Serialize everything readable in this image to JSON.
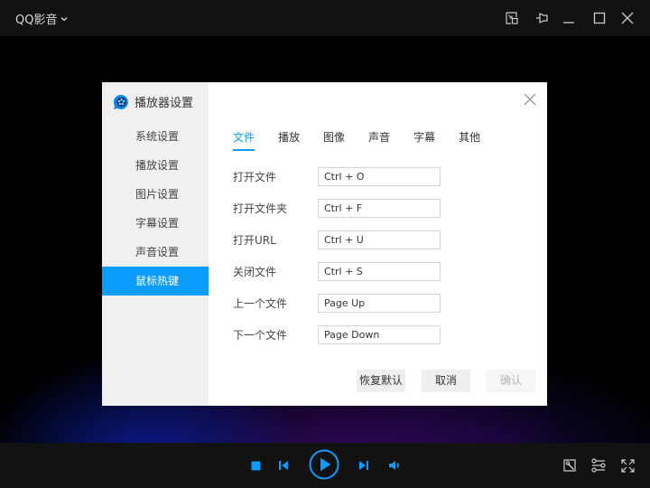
{
  "app": {
    "title": "QQ影音",
    "window_controls": [
      "mini-mode",
      "pin",
      "minimize",
      "maximize",
      "close"
    ]
  },
  "dialog": {
    "title": "播放器设置",
    "sidebar": {
      "items": [
        {
          "label": "系统设置",
          "active": false
        },
        {
          "label": "播放设置",
          "active": false
        },
        {
          "label": "图片设置",
          "active": false
        },
        {
          "label": "字幕设置",
          "active": false
        },
        {
          "label": "声音设置",
          "active": false
        },
        {
          "label": "鼠标热键",
          "active": true
        }
      ]
    },
    "tabs": [
      {
        "label": "文件",
        "active": true
      },
      {
        "label": "播放",
        "active": false
      },
      {
        "label": "图像",
        "active": false
      },
      {
        "label": "声音",
        "active": false
      },
      {
        "label": "字幕",
        "active": false
      },
      {
        "label": "其他",
        "active": false
      }
    ],
    "hotkeys": [
      {
        "label": "打开文件",
        "value": "Ctrl + O"
      },
      {
        "label": "打开文件夹",
        "value": "Ctrl + F"
      },
      {
        "label": "打开URL",
        "value": "Ctrl + U"
      },
      {
        "label": "关闭文件",
        "value": "Ctrl + S"
      },
      {
        "label": "上一个文件",
        "value": "Page Up"
      },
      {
        "label": "下一个文件",
        "value": "Page Down"
      }
    ],
    "buttons": {
      "restore_default": "恢复默认",
      "cancel": "取消",
      "confirm": "确认"
    }
  },
  "colors": {
    "accent": "#0a9cff",
    "bar_bg": "#121212",
    "sidebar_bg": "#f0f0f0"
  }
}
